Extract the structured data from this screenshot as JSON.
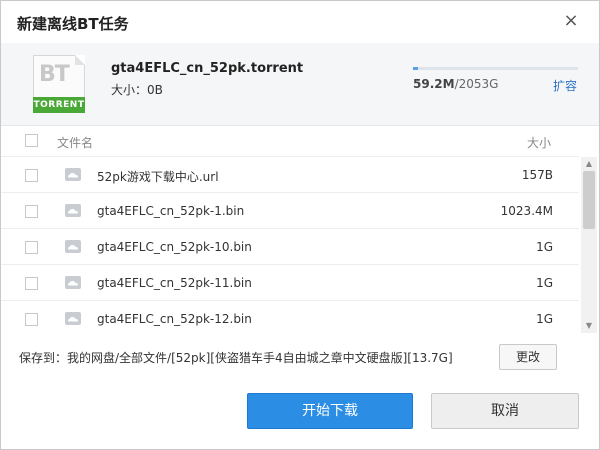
{
  "dialog": {
    "title": "新建离线BT任务",
    "close_glyph": "×"
  },
  "torrent": {
    "icon_label": "BT",
    "icon_strip": "TORRENT",
    "name": "gta4EFLC_cn_52pk.torrent",
    "size": "大小：0B"
  },
  "quota": {
    "used": "59.2M",
    "total": "/2053G",
    "used_fraction": 0.03,
    "expand": "扩容"
  },
  "list": {
    "header_name": "文件名",
    "header_size": "大小",
    "rows": [
      {
        "name": "52pk游戏下载中心.url",
        "size": "157B"
      },
      {
        "name": "gta4EFLC_cn_52pk-1.bin",
        "size": "1023.4M"
      },
      {
        "name": "gta4EFLC_cn_52pk-10.bin",
        "size": "1G"
      },
      {
        "name": "gta4EFLC_cn_52pk-11.bin",
        "size": "1G"
      },
      {
        "name": "gta4EFLC_cn_52pk-12.bin",
        "size": "1G"
      }
    ]
  },
  "footer": {
    "save_path": "保存到：我的网盘/全部文件/[52pk][侠盗猎车手4自由城之章中文硬盘版][13.7G]",
    "change": "更改",
    "start": "开始下载",
    "cancel": "取消"
  },
  "colors": {
    "primary": "#2c8de5",
    "link": "#2b72c7",
    "torrent_badge": "#4aa837"
  },
  "icons": {
    "close": "close-icon",
    "torrent": "torrent-file-icon",
    "file": "cloud-file-icon"
  }
}
